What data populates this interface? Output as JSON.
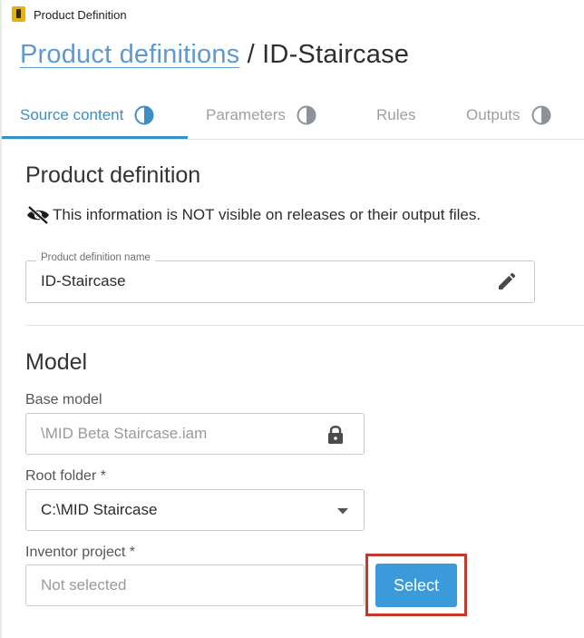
{
  "window": {
    "title": "Product Definition",
    "icon": "inventor-app-icon"
  },
  "breadcrumb": {
    "link": "Product definitions",
    "separator": " / ",
    "current": "ID-Staircase"
  },
  "tabs": [
    {
      "label": "Source content",
      "active": true,
      "status_icon": "half-circle-icon"
    },
    {
      "label": "Parameters",
      "active": false,
      "status_icon": "half-circle-icon"
    },
    {
      "label": "Rules",
      "active": false
    },
    {
      "label": "Outputs",
      "active": false,
      "status_icon": "half-circle-icon"
    }
  ],
  "product_definition": {
    "heading": "Product definition",
    "notice": "This information is NOT visible on releases or their output files.",
    "name_field": {
      "legend": "Product definition name",
      "value": "ID-Staircase"
    }
  },
  "model": {
    "heading": "Model",
    "base_model": {
      "label": "Base model",
      "value": "\\MID Beta Staircase.iam",
      "icon": "lock-icon"
    },
    "root_folder": {
      "label": "Root folder *",
      "value": "C:\\MID Staircase",
      "icon": "chevron-down-icon"
    },
    "inventor_project": {
      "label": "Inventor project *",
      "placeholder": "Not selected",
      "button": "Select"
    }
  },
  "colors": {
    "accent": "#3a8fc7",
    "button": "#3b9ad9",
    "link": "#5b9ad3",
    "highlight": "#c0392b"
  }
}
